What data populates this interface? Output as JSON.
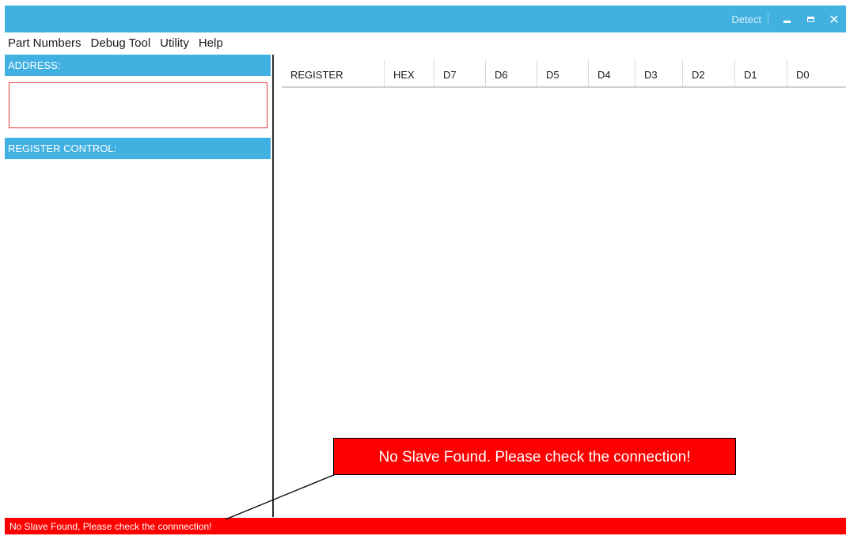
{
  "titlebar": {
    "title": "",
    "detect_label": "Detect",
    "minimize_icon": "minimize-icon",
    "maximize_icon": "maximize-icon",
    "close_label": "✕"
  },
  "menu": [
    "Part Numbers",
    "Debug Tool",
    "Utility",
    "Help"
  ],
  "left_panel": {
    "address_header": "ADDRESS:",
    "register_control_header": "REGISTER CONTROL:"
  },
  "grid": {
    "columns": [
      "REGISTER",
      "HEX",
      "D7",
      "D6",
      "D5",
      "D4",
      "D3",
      "D2",
      "D1",
      "D0"
    ]
  },
  "status": "No Slave Found, Please check the connnection!",
  "callout": "No Slave Found. Please check the connection!",
  "colors": {
    "accent": "#41b1e1",
    "error": "#ff0000",
    "address_border": "#e23a3a"
  }
}
